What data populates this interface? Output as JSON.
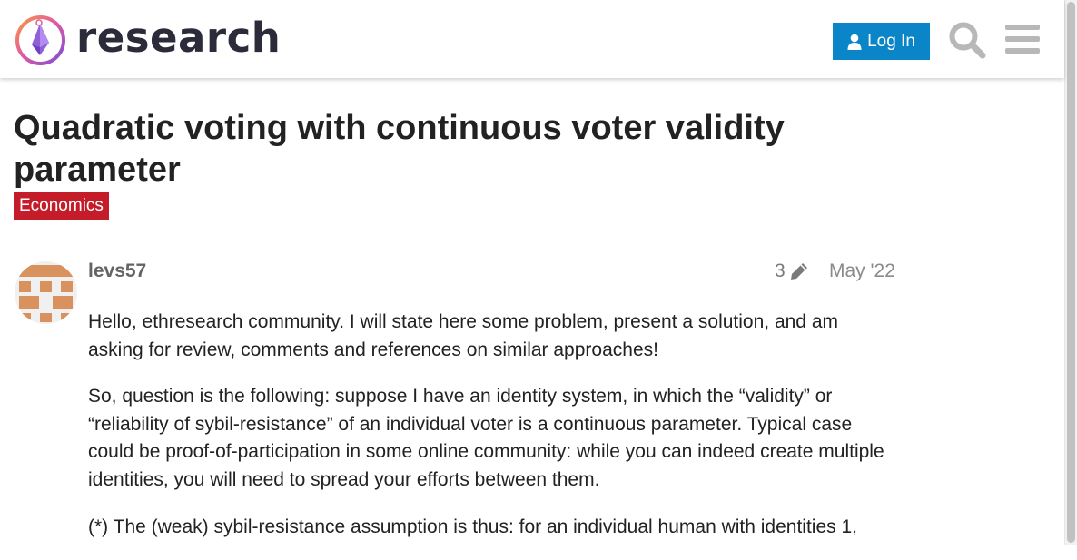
{
  "site": {
    "brand": "research",
    "login_label": "Log In",
    "accent": "#0a86c8"
  },
  "icons": {
    "logo": "ethresearch-logo",
    "login": "user-icon",
    "search": "search-icon",
    "menu": "hamburger-menu-icon",
    "edit": "pencil-icon"
  },
  "topic": {
    "title": "Quadratic voting with continuous voter validity parameter",
    "category": "Economics",
    "category_color": "#c51c2a"
  },
  "post": {
    "username": "levs57",
    "edit_count": "3",
    "date": "May '22",
    "paragraphs": [
      "Hello, ethresearch community. I will state here some problem, present a solution, and am asking for review, comments and references on similar approaches!",
      "So, question is the following: suppose I have an identity system, in which the “validity” or “reliability of sybil-resistance” of an individual voter is a continuous parameter. Typical case could be proof-of-participation in some online community: while you can indeed create multiple identities, you will need to spread your efforts between them.",
      "(*) The (weak) sybil-resistance assumption is thus: for an individual human with identities 1,"
    ]
  }
}
